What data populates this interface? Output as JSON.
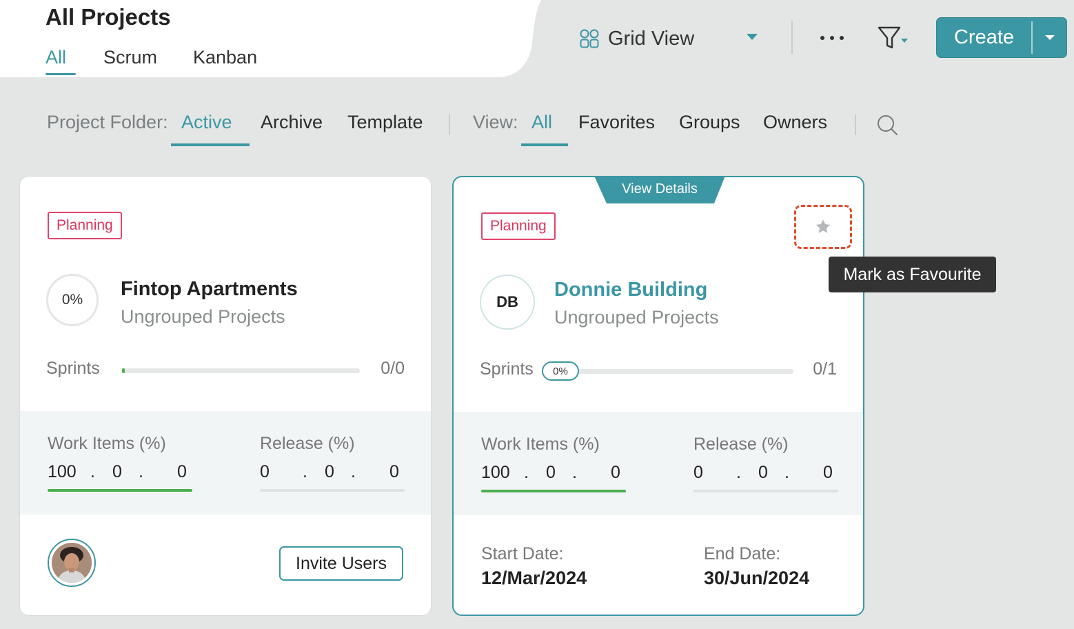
{
  "header": {
    "title": "All Projects",
    "type_tabs": [
      {
        "label": "All",
        "active": true
      },
      {
        "label": "Scrum",
        "active": false
      },
      {
        "label": "Kanban",
        "active": false
      }
    ],
    "view_selector": {
      "label": "Grid View",
      "icon": "grid-icon"
    },
    "more_icon": "more-horizontal-icon",
    "filter_icon": "filter-icon",
    "create_label": "Create"
  },
  "filters": {
    "folder_label": "Project Folder:",
    "folder_options": [
      {
        "label": "Active",
        "active": true
      },
      {
        "label": "Archive",
        "active": false
      },
      {
        "label": "Template",
        "active": false
      }
    ],
    "view_label": "View:",
    "view_options": [
      {
        "label": "All",
        "active": true
      },
      {
        "label": "Favorites",
        "active": false
      },
      {
        "label": "Groups",
        "active": false
      },
      {
        "label": "Owners",
        "active": false
      }
    ],
    "search_icon": "search-icon"
  },
  "cards": [
    {
      "status": "Planning",
      "progress": "0%",
      "name": "Fintop Apartments",
      "group": "Ungrouped Projects",
      "sprints_label": "Sprints",
      "sprints_count": "0/0",
      "work_items": {
        "title": "Work Items (%)",
        "v1": "100",
        "v2": "0",
        "v3": "0"
      },
      "release": {
        "title": "Release (%)",
        "v1": "0",
        "v2": "0",
        "v3": "0"
      },
      "dot": ".",
      "invite_label": "Invite Users"
    },
    {
      "view_details": "View Details",
      "status": "Planning",
      "initials": "DB",
      "name": "Donnie Building",
      "group": "Ungrouped Projects",
      "sprints_label": "Sprints",
      "sprint_progress": "0%",
      "sprints_count": "0/1",
      "work_items": {
        "title": "Work Items (%)",
        "v1": "100",
        "v2": "0",
        "v3": "0"
      },
      "release": {
        "title": "Release (%)",
        "v1": "0",
        "v2": "0",
        "v3": "0"
      },
      "dot": ".",
      "start_label": "Start Date:",
      "start_date": "12/Mar/2024",
      "end_label": "End Date:",
      "end_date": "30/Jun/2024",
      "favourite_icon": "star-icon",
      "tooltip": "Mark as Favourite"
    }
  ],
  "colors": {
    "accent": "#3b97a3",
    "background": "#e4e6e6",
    "badge": "#d9345d",
    "progress_green": "#4caf50",
    "focus_ring": "#e04a2e"
  }
}
